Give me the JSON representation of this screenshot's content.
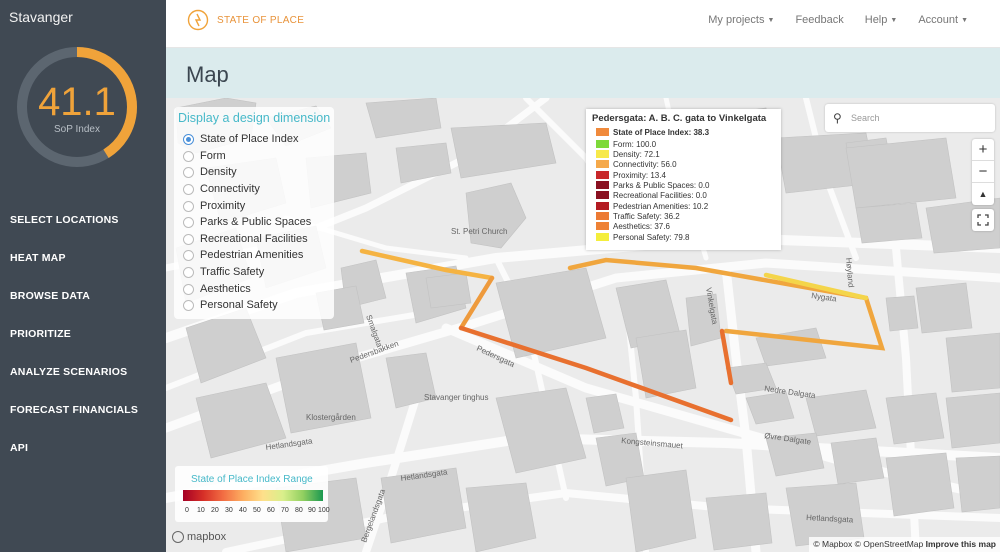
{
  "sidebar": {
    "city": "Stavanger",
    "gauge": {
      "value": "41.1",
      "label": "SoP Index",
      "fraction": 0.411
    },
    "items": [
      {
        "label": "SELECT LOCATIONS"
      },
      {
        "label": "HEAT MAP"
      },
      {
        "label": "BROWSE DATA"
      },
      {
        "label": "PRIORITIZE"
      },
      {
        "label": "ANALYZE SCENARIOS"
      },
      {
        "label": "FORECAST FINANCIALS"
      },
      {
        "label": "API"
      }
    ]
  },
  "topbar": {
    "logo_text": "STATE OF PLACE",
    "nav": [
      {
        "label": "My projects",
        "caret": true
      },
      {
        "label": "Feedback",
        "caret": false
      },
      {
        "label": "Help",
        "caret": true
      },
      {
        "label": "Account",
        "caret": true
      }
    ]
  },
  "page": {
    "title": "Map"
  },
  "dimension_panel": {
    "title": "Display a design dimension",
    "options": [
      {
        "label": "State of Place Index",
        "selected": true
      },
      {
        "label": "Form",
        "selected": false
      },
      {
        "label": "Density",
        "selected": false
      },
      {
        "label": "Connectivity",
        "selected": false
      },
      {
        "label": "Proximity",
        "selected": false
      },
      {
        "label": "Parks & Public Spaces",
        "selected": false
      },
      {
        "label": "Recreational Facilities",
        "selected": false
      },
      {
        "label": "Pedestrian Amenities",
        "selected": false
      },
      {
        "label": "Traffic Safety",
        "selected": false
      },
      {
        "label": "Aesthetics",
        "selected": false
      },
      {
        "label": "Personal Safety",
        "selected": false
      }
    ]
  },
  "info_popup": {
    "title": "Pedersgata: A. B. C. gata to Vinkelgata",
    "rows": [
      {
        "text": "State of Place Index: 38.3",
        "color": "#f08a3c",
        "bold": true
      },
      {
        "text": "Form: 100.0",
        "color": "#7ed93a",
        "bold": false
      },
      {
        "text": "Density: 72.1",
        "color": "#f7e94a",
        "bold": false
      },
      {
        "text": "Connectivity: 56.0",
        "color": "#f5a94a",
        "bold": false
      },
      {
        "text": "Proximity: 13.4",
        "color": "#c8282a",
        "bold": false
      },
      {
        "text": "Parks & Public Spaces: 0.0",
        "color": "#8a1020",
        "bold": false
      },
      {
        "text": "Recreational Facilities: 0.0",
        "color": "#8a1020",
        "bold": false
      },
      {
        "text": "Pedestrian Amenities: 10.2",
        "color": "#b31b22",
        "bold": false
      },
      {
        "text": "Traffic Safety: 36.2",
        "color": "#ec7a34",
        "bold": false
      },
      {
        "text": "Aesthetics: 37.6",
        "color": "#ee8236",
        "bold": false
      },
      {
        "text": "Personal Safety: 79.8",
        "color": "#f4ee3c",
        "bold": false
      }
    ]
  },
  "search": {
    "placeholder": "Search",
    "value": ""
  },
  "zoom": {
    "in": "+",
    "out": "−",
    "compass": "▲"
  },
  "legend": {
    "title": "State of Place Index Range",
    "ticks": [
      "0",
      "10",
      "20",
      "30",
      "40",
      "50",
      "60",
      "70",
      "80",
      "90",
      "100"
    ]
  },
  "map_labels": {
    "st_peter": "St. Petri Church",
    "pedersgata": "Pedersgata",
    "pedersbakken": "Pedersbakken",
    "klostergarden": "Klostergården",
    "stavanger_tinghus": "Stavanger tinghus",
    "hetlandsgata": "Hetlandsgata",
    "bergelandsgata": "Bergelandsgata",
    "kongsteinsmauet": "Kongsteinsmauet",
    "nedre_dalgata": "Nedre Dalgata",
    "ovre_dalgata": "Øvre Dalgate",
    "nygata": "Nygata",
    "vinkelgata": "Vinkelgata",
    "smalgata": "Smalgata",
    "hoyland": "Høyland"
  },
  "mapbox": {
    "logo": "mapbox",
    "copyright": "© Mapbox © OpenStreetMap",
    "improve": "Improve this map"
  }
}
